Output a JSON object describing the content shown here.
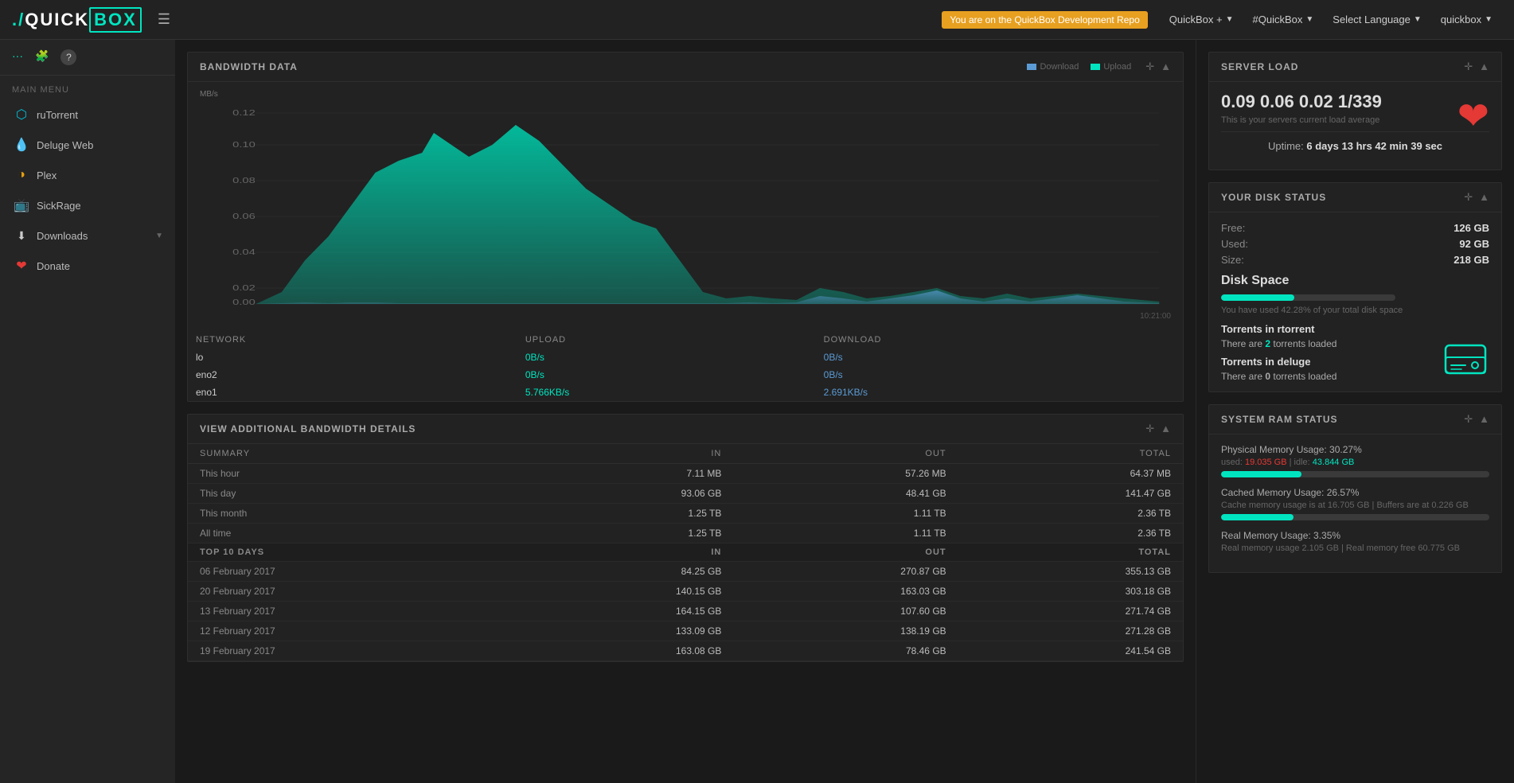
{
  "navbar": {
    "brand": "./QUICKBOX",
    "toggle_icon": "☰",
    "badge_text": "You are on the QuickBox Development Repo",
    "nav_items": [
      {
        "label": "QuickBox +",
        "id": "quickbox-menu"
      },
      {
        "label": "#QuickBox",
        "id": "quickbox-hash"
      },
      {
        "label": "Select Language",
        "id": "select-language"
      },
      {
        "label": "quickbox",
        "id": "user-menu"
      }
    ]
  },
  "sidebar": {
    "icons": [
      "...",
      "🧩",
      "?"
    ],
    "section_label": "MAIN MENU",
    "items": [
      {
        "label": "ruTorrent",
        "icon": "rutorrent",
        "id": "rutorrent"
      },
      {
        "label": "Deluge Web",
        "icon": "deluge",
        "id": "deluge"
      },
      {
        "label": "Plex",
        "icon": "plex",
        "id": "plex"
      },
      {
        "label": "SickRage",
        "icon": "sickrage",
        "id": "sickrage"
      },
      {
        "label": "Downloads",
        "icon": "downloads",
        "id": "downloads",
        "has_submenu": true
      },
      {
        "label": "Donate",
        "icon": "donate",
        "id": "donate"
      }
    ]
  },
  "bandwidth_widget": {
    "title": "BANDWIDTH DATA",
    "y_label": "MB/s",
    "legend": [
      {
        "label": "Download",
        "color": "download"
      },
      {
        "label": "Upload",
        "color": "upload"
      }
    ],
    "timestamp": "10:21:00",
    "network_headers": [
      "NETWORK",
      "UPLOAD",
      "DOWNLOAD"
    ],
    "network_rows": [
      {
        "network": "lo",
        "upload": "0B/s",
        "download": "0B/s"
      },
      {
        "network": "eno2",
        "upload": "0B/s",
        "download": "0B/s"
      },
      {
        "network": "eno1",
        "upload": "5.766KB/s",
        "download": "2.691KB/s"
      }
    ]
  },
  "bandwidth_details": {
    "title": "VIEW ADDITIONAL BANDWIDTH DETAILS",
    "summary_headers": [
      "SUMMARY",
      "IN",
      "OUT",
      "TOTAL"
    ],
    "summary_rows": [
      {
        "period": "This hour",
        "in": "7.11 MB",
        "out": "57.26 MB",
        "total": "64.37 MB"
      },
      {
        "period": "This day",
        "in": "93.06 GB",
        "out": "48.41 GB",
        "total": "141.47 GB"
      },
      {
        "period": "This month",
        "in": "1.25 TB",
        "out": "1.11 TB",
        "total": "2.36 TB"
      },
      {
        "period": "All time",
        "in": "1.25 TB",
        "out": "1.11 TB",
        "total": "2.36 TB"
      }
    ],
    "top10_headers": [
      "TOP 10 DAYS",
      "IN",
      "OUT",
      "TOTAL"
    ],
    "top10_rows": [
      {
        "date": "06 February 2017",
        "in": "84.25 GB",
        "out": "270.87 GB",
        "total": "355.13 GB"
      },
      {
        "date": "20 February 2017",
        "in": "140.15 GB",
        "out": "163.03 GB",
        "total": "303.18 GB"
      },
      {
        "date": "13 February 2017",
        "in": "164.15 GB",
        "out": "107.60 GB",
        "total": "271.74 GB"
      },
      {
        "date": "12 February 2017",
        "in": "133.09 GB",
        "out": "138.19 GB",
        "total": "271.28 GB"
      },
      {
        "date": "19 February 2017",
        "in": "163.08 GB",
        "out": "78.46 GB",
        "total": "241.54 GB"
      }
    ]
  },
  "server_load": {
    "title": "SERVER LOAD",
    "load_value": "0.09 0.06 0.02 1/339",
    "load_desc": "This is your servers current load average",
    "uptime_label": "Uptime:",
    "uptime_days": "6",
    "uptime_hrs": "13",
    "uptime_min": "42",
    "uptime_sec": "39",
    "uptime_text": "6 days 13 hrs 42 min 39 sec"
  },
  "disk_status": {
    "title": "YOUR DISK STATUS",
    "free_label": "Free:",
    "free_value": "126 GB",
    "used_label": "Used:",
    "used_value": "92 GB",
    "size_label": "Size:",
    "size_value": "218 GB",
    "disk_space_label": "Disk Space",
    "progress_pct": 42,
    "usage_text": "You have used 42.28% of your total disk space"
  },
  "torrents": {
    "rtorrent_label": "Torrents in rtorrent",
    "rtorrent_text": "There are",
    "rtorrent_count": "2",
    "rtorrent_suffix": "torrents loaded",
    "deluge_label": "Torrents in deluge",
    "deluge_text": "There are",
    "deluge_count": "0",
    "deluge_suffix": "torrents loaded"
  },
  "ram_status": {
    "title": "SYSTEM RAM STATUS",
    "physical_label": "Physical Memory Usage: 30.27%",
    "physical_sub": "used: 19.035 GB | idle: 43.844 GB",
    "physical_pct": 30,
    "cached_label": "Cached Memory Usage: 26.57%",
    "cached_sub": "Cache memory usage is at 16.705 GB | Buffers are at 0.226 GB",
    "cached_pct": 27,
    "real_label": "Real Memory Usage: 3.35%",
    "real_sub": "Real memory usage 2.105 GB | Real memory free 60.775 GB",
    "real_pct": 3
  }
}
